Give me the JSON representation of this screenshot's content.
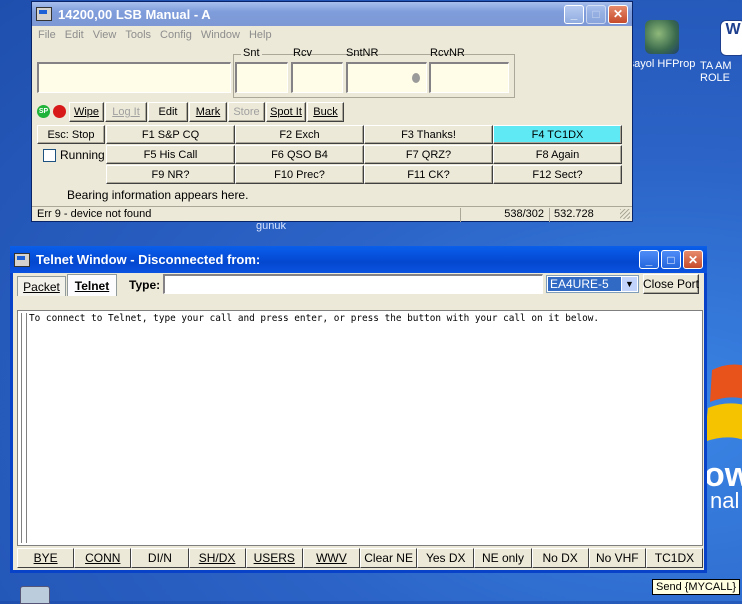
{
  "desktop": {
    "icons": [
      {
        "label": "sayol HFProp"
      },
      {
        "label": "TA AM ROLE"
      }
    ],
    "background_text": "ow",
    "background_text2": "nal",
    "taskbar_label": "gunuk"
  },
  "main_window": {
    "title": "14200,00 LSB Manual - A",
    "menu": [
      "File",
      "Edit",
      "View",
      "Tools",
      "Config",
      "Window",
      "Help"
    ],
    "field_labels": {
      "snt": "Snt",
      "rcv": "Rcv",
      "sntnr": "SntNR",
      "rcvnr": "RcvNR"
    },
    "fields": {
      "call": "",
      "snt": "",
      "rcv": "",
      "sntnr": "",
      "rcvnr": ""
    },
    "toolbar": {
      "wipe": "Wipe",
      "log_it": "Log It",
      "edit": "Edit",
      "mark": "Mark",
      "store": "Store",
      "spot_it": "Spot It",
      "buck": "Buck"
    },
    "esc_stop": "Esc: Stop",
    "running_label": "Running",
    "function_keys": [
      "F1 S&P CQ",
      "F2 Exch",
      "F3 Thanks!",
      "F4 TC1DX",
      "F5 His Call",
      "F6 QSO B4",
      "F7 QRZ?",
      "F8 Again",
      "F9 NR?",
      "F10 Prec?",
      "F11 CK?",
      "F12 Sect?"
    ],
    "bearing_info": "Bearing information appears here.",
    "status": {
      "message": "Err 9 - device not found",
      "coords": "538/302",
      "value": "532.728"
    },
    "colors": {
      "highlight_key": "#5ee9f4"
    }
  },
  "telnet_window": {
    "title": "Telnet Window - Disconnected from:",
    "tabs": [
      "Packet",
      "Telnet"
    ],
    "type_label": "Type:",
    "type_value": "",
    "cluster_select": "EA4URE-5",
    "close_port": "Close Port",
    "message": "To connect to Telnet, type your call and press enter, or press the button with your call on it below.",
    "bottom_buttons": [
      "BYE",
      "CONN",
      "DI/N",
      "SH/DX",
      "USERS",
      "WWV",
      "Clear NE",
      "Yes DX",
      "NE only",
      "No DX",
      "No VHF",
      "TC1DX"
    ],
    "tooltip": "Send {MYCALL}"
  }
}
